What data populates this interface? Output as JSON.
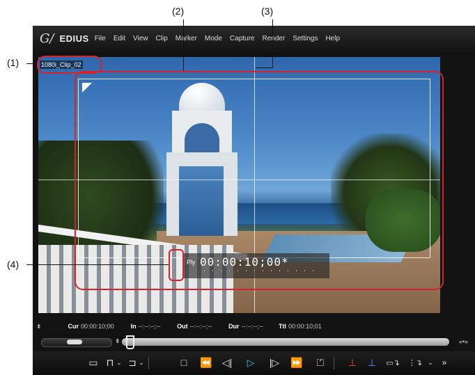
{
  "callouts": {
    "c1": "(1)",
    "c2": "(2)",
    "c3": "(3)",
    "c4": "(4)"
  },
  "app": {
    "logo_mark": "G/",
    "logo_name": "EDIUS",
    "menu": [
      "File",
      "Edit",
      "View",
      "Clip",
      "Marker",
      "Mode",
      "Capture",
      "Render",
      "Settings",
      "Help"
    ]
  },
  "viewer": {
    "clip_name": "1080i_Clip_02",
    "tc_label": "Ply",
    "tc_value": "00:00:10;00*"
  },
  "timecodes": {
    "cur_label": "Cur",
    "cur_value": "00:00:10;00",
    "in_label": "In",
    "in_value": "--:--:--;--",
    "out_label": "Out",
    "out_value": "--:--:--;--",
    "dur_label": "Dur",
    "dur_value": "--:--:--;--",
    "ttl_label": "Ttl",
    "ttl_value": "00:00:10;01"
  },
  "controls": {
    "icons": [
      "insert-mode-icon",
      "set-in-icon",
      "set-out-icon",
      "stop-icon",
      "rewind-icon",
      "step-back-icon",
      "play-icon",
      "step-forward-icon",
      "fast-forward-icon",
      "loop-play-icon",
      "insert-to-timeline-icon",
      "overwrite-to-timeline-icon",
      "match-frame-icon",
      "more-icon"
    ],
    "play_color": "#3fc2ef",
    "insert_color": "#f04a1a",
    "overwrite_color": "#3aa0ff"
  }
}
